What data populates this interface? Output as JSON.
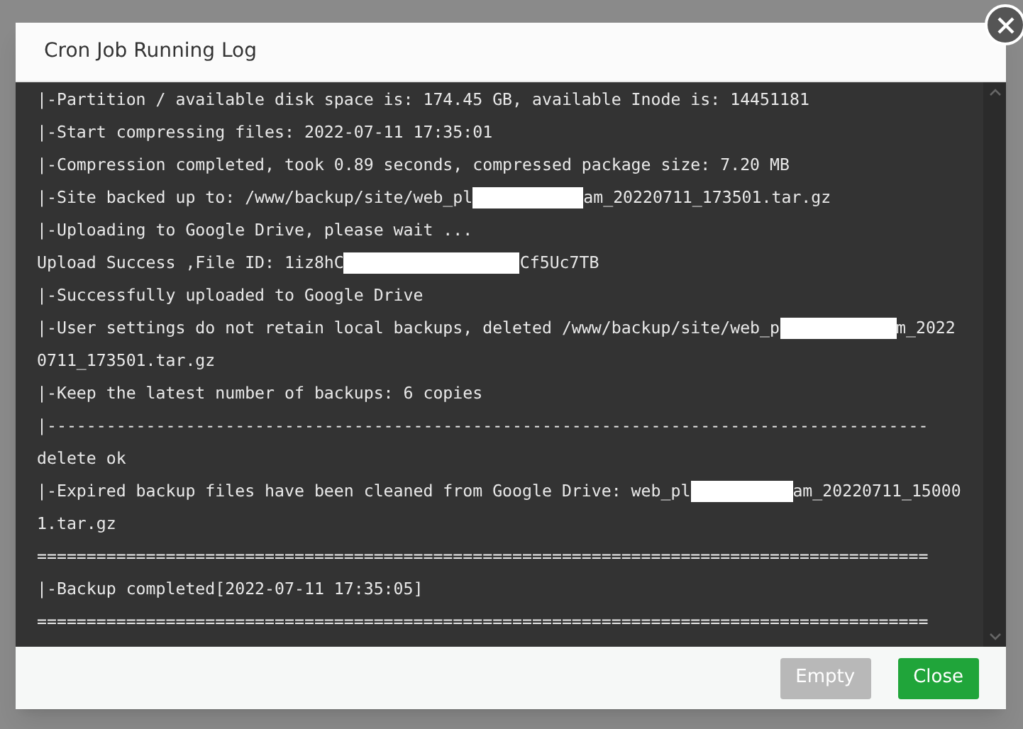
{
  "dialog": {
    "title": "Cron Job Running Log",
    "log_lines": [
      {
        "segments": [
          {
            "kind": "text",
            "text": "|-Partition / available disk space is: 174.45 GB, available Inode is: 14451181"
          }
        ]
      },
      {
        "segments": [
          {
            "kind": "text",
            "text": "|-Start compressing files: 2022-07-11 17:35:01"
          }
        ]
      },
      {
        "segments": [
          {
            "kind": "text",
            "text": "|-Compression completed, took 0.89 seconds, compressed package size: 7.20 MB"
          }
        ]
      },
      {
        "segments": [
          {
            "kind": "text",
            "text": "|-Site backed up to: /www/backup/site/web_pl"
          },
          {
            "kind": "redacted"
          },
          {
            "kind": "text",
            "text": "am_20220711_173501.tar.gz"
          }
        ]
      },
      {
        "segments": [
          {
            "kind": "text",
            "text": "|-Uploading to Google Drive, please wait ..."
          }
        ]
      },
      {
        "segments": [
          {
            "kind": "text",
            "text": "Upload Success ,File ID: 1iz8hC"
          },
          {
            "kind": "redacted"
          },
          {
            "kind": "text",
            "text": "Cf5Uc7TB"
          }
        ]
      },
      {
        "segments": [
          {
            "kind": "text",
            "text": "|-Successfully uploaded to Google Drive"
          }
        ]
      },
      {
        "segments": [
          {
            "kind": "text",
            "text": "|-User settings do not retain local backups, deleted /www/backup/site/web_p"
          },
          {
            "kind": "redacted"
          },
          {
            "kind": "text",
            "text": "m_2022"
          }
        ]
      },
      {
        "segments": [
          {
            "kind": "text",
            "text": "0711_173501.tar.gz"
          }
        ]
      },
      {
        "segments": [
          {
            "kind": "text",
            "text": "|-Keep the latest number of backups: 6 copies"
          }
        ]
      },
      {
        "segments": [
          {
            "kind": "text",
            "text": "|-----------------------------------------------------------------------------------------"
          }
        ]
      },
      {
        "segments": [
          {
            "kind": "text",
            "text": "delete ok"
          }
        ]
      },
      {
        "segments": [
          {
            "kind": "text",
            "text": "|-Expired backup files have been cleaned from Google Drive: web_pl"
          },
          {
            "kind": "redacted"
          },
          {
            "kind": "text",
            "text": "am_20220711_15000"
          }
        ]
      },
      {
        "segments": [
          {
            "kind": "text",
            "text": "1.tar.gz"
          }
        ]
      },
      {
        "segments": [
          {
            "kind": "text",
            "text": "=========================================================================================="
          }
        ]
      },
      {
        "segments": [
          {
            "kind": "text",
            "text": "|-Backup completed[2022-07-11 17:35:05]"
          }
        ]
      },
      {
        "segments": [
          {
            "kind": "text",
            "text": "=========================================================================================="
          }
        ]
      }
    ],
    "buttons": [
      {
        "label": "Empty",
        "kind": "secondary"
      },
      {
        "label": "Close",
        "kind": "primary"
      }
    ]
  }
}
